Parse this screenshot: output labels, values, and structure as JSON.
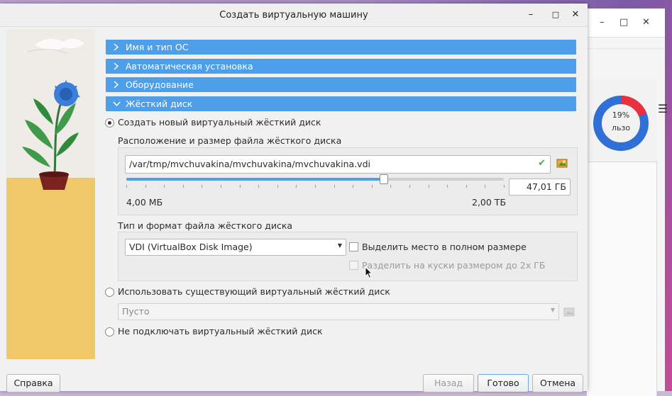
{
  "dialog": {
    "title": "Создать виртуальную машину",
    "window_buttons": {
      "minimize": "–",
      "maximize": "□",
      "close": "✕"
    }
  },
  "sections": [
    {
      "label": "Имя и тип ОС",
      "expanded": false
    },
    {
      "label": "Автоматическая установка",
      "expanded": false
    },
    {
      "label": "Оборудование",
      "expanded": false
    },
    {
      "label": "Жёсткий диск",
      "expanded": true
    }
  ],
  "disk": {
    "option_new": {
      "label": "Создать новый виртуальный жёсткий диск",
      "selected": true
    },
    "location_label": "Расположение и размер файла жёсткого диска",
    "path_value": "/var/tmp/mvchuvakina/mvchuvakina/mvchuvakina.vdi",
    "size_value": "47,01 ГБ",
    "size_min_label": "4,00 МБ",
    "size_max_label": "2,00 ТБ",
    "size_slider_level": 0.68,
    "format_label": "Тип и формат файла жёсткого диска",
    "format_selected": "VDI (VirtualBox Disk Image)",
    "preallocate": {
      "label": "Выделить место в полном размере",
      "checked": false
    },
    "split": {
      "label": "Разделить на куски размером до 2х ГБ",
      "checked": false,
      "enabled": false
    },
    "option_existing": {
      "label": "Использовать существующий виртуальный жёсткий диск",
      "selected": false
    },
    "existing_value": "Пусто",
    "option_none": {
      "label": "Не подключать виртуальный жёсткий диск",
      "selected": false
    }
  },
  "footer": {
    "help": "Справка",
    "back": "Назад",
    "finish": "Готово",
    "cancel": "Отмена"
  },
  "background_window": {
    "window_buttons": {
      "minimize": "–",
      "maximize": "□",
      "close": "✕"
    },
    "usage_percent": "19%",
    "usage_label": "льзо",
    "usage_fraction": 0.19
  },
  "colors": {
    "accent": "#4d9fea",
    "donut_used": "#e8303f",
    "donut_free": "#2f6fd6"
  }
}
